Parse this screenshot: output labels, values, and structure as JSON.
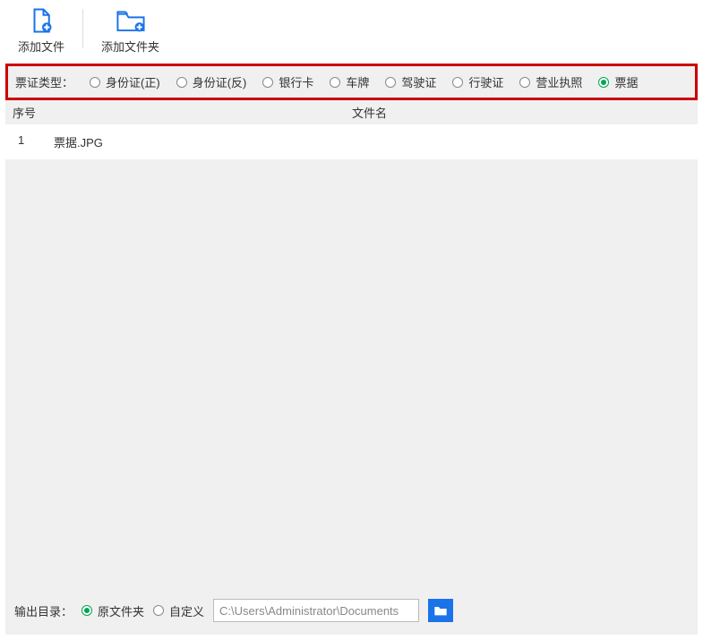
{
  "toolbar": {
    "add_file": "添加文件",
    "add_folder": "添加文件夹"
  },
  "ticketType": {
    "label": "票证类型：",
    "options": [
      {
        "label": "身份证(正)"
      },
      {
        "label": "身份证(反)"
      },
      {
        "label": "银行卡"
      },
      {
        "label": "车牌"
      },
      {
        "label": "驾驶证"
      },
      {
        "label": "行驶证"
      },
      {
        "label": "营业执照"
      },
      {
        "label": "票据"
      }
    ],
    "selectedIndex": 7
  },
  "table": {
    "header": {
      "num": "序号",
      "name": "文件名"
    },
    "rows": [
      {
        "num": "1",
        "name": "票据.JPG"
      }
    ]
  },
  "output": {
    "label": "输出目录：",
    "options": [
      {
        "label": "原文件夹"
      },
      {
        "label": "自定义"
      }
    ],
    "selectedIndex": 0,
    "path": "C:\\Users\\Administrator\\Documents"
  }
}
